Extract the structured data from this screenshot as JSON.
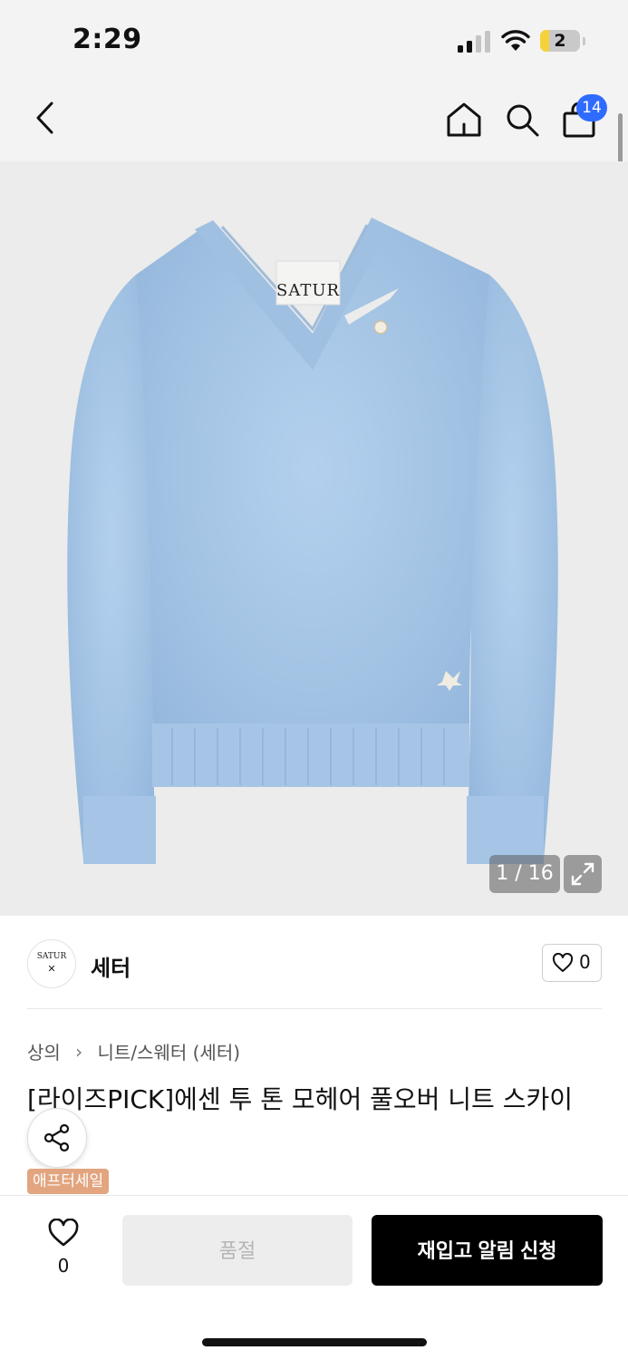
{
  "status_bar": {
    "time": "2:29",
    "battery_level": "2",
    "battery_fraction": 0.22,
    "battery_color": "#f5d23a"
  },
  "nav": {
    "back_icon": "chevron-left-icon",
    "home_icon": "home-icon",
    "search_icon": "search-icon",
    "cart_icon": "shopping-bag-icon",
    "cart_count": "14",
    "badge_color": "#2f6bff"
  },
  "product_image": {
    "counter": "1 / 16",
    "expand_icon": "expand-icon",
    "label_text": "SATUR",
    "sweater_color": "#a9c8e8"
  },
  "brand": {
    "logo_text": "SATUR",
    "name": "세터",
    "like_count": "0"
  },
  "breadcrumb": {
    "category": "상의",
    "separator": "›",
    "subcategory": "니트/스웨터 (세터)"
  },
  "product": {
    "title": "[라이즈PICK]에센 투 톤 모헤어 풀오버 니트 스카이 블루",
    "sale_tag": "애프터세일",
    "sale_tag_color": "#e2a57f"
  },
  "bottom_bar": {
    "wish_count": "0",
    "soldout_label": "품절",
    "restock_label": "재입고 알림 신청"
  }
}
